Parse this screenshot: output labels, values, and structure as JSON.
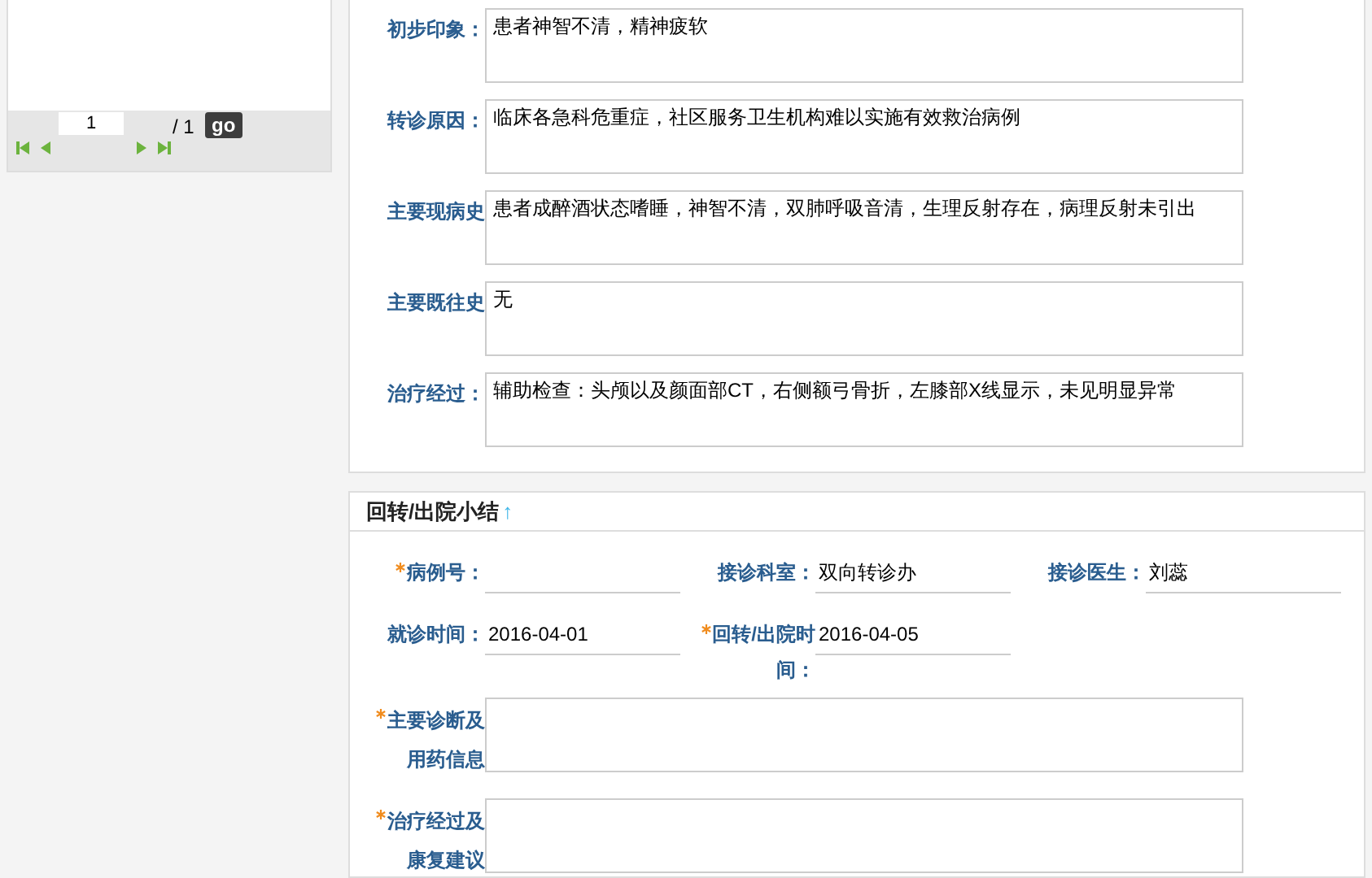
{
  "pager": {
    "page_value": "1",
    "total": "/ 1",
    "go_label": "go"
  },
  "history_fields": [
    {
      "label": "初步印象：",
      "value": "患者神智不清，精神疲软"
    },
    {
      "label": "转诊原因：",
      "value": "临床各急科危重症，社区服务卫生机构难以实施有效救治病例"
    },
    {
      "label": "主要现病史",
      "value": "患者成醉酒状态嗜睡，神智不清，双肺呼吸音清，生理反射存在，病理反射未引出"
    },
    {
      "label": "主要既往史",
      "value": "无"
    },
    {
      "label": "治疗经过：",
      "value": "辅助检查：头颅以及颜面部CT，右侧额弓骨折，左膝部X线显示，未见明显异常"
    }
  ],
  "summary": {
    "title": "回转/出院小结",
    "title_icon": "↑",
    "fields": [
      {
        "label": "病例号：",
        "required": true
      },
      {
        "label": "接诊科室：",
        "required": false,
        "value": "双向转诊办"
      },
      {
        "label": "接诊医生：",
        "required": false,
        "value": "刘蕊"
      },
      {
        "label": "就诊时间：",
        "required": false,
        "value": "2016-04-01"
      },
      {
        "label": "回转/出院时间：",
        "required": true,
        "value": "2016-04-05"
      }
    ],
    "text_areas": [
      {
        "label": "主要诊断及用药信息",
        "required": true
      },
      {
        "label": "治疗经过及康复建议",
        "required": true
      }
    ]
  }
}
